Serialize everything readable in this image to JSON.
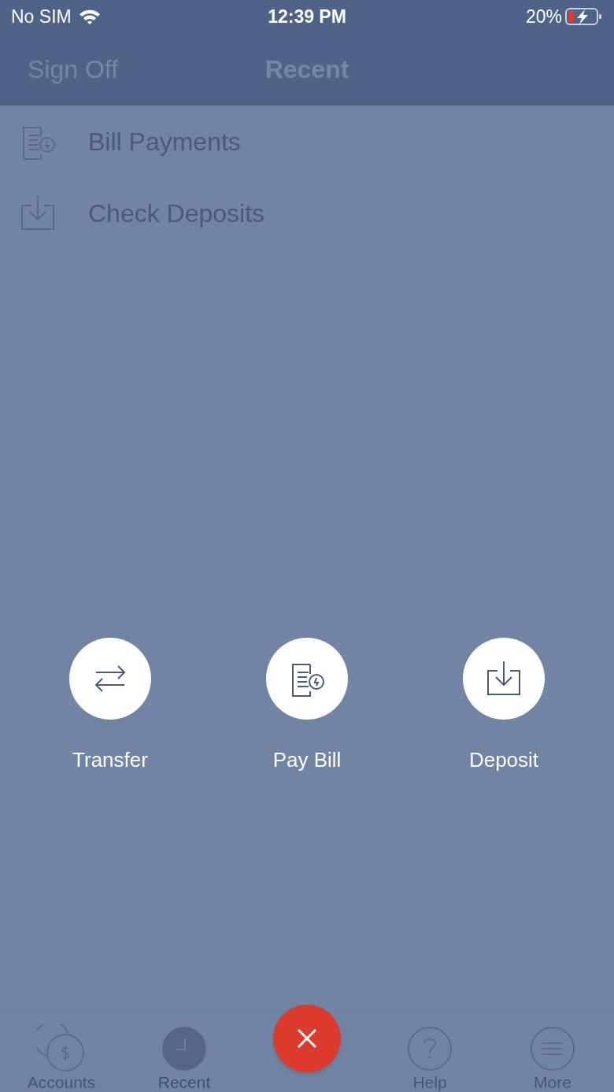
{
  "status_bar": {
    "carrier": "No SIM",
    "time": "12:39 PM",
    "battery": "20%"
  },
  "header": {
    "left_button": "Sign Off",
    "title": "Recent"
  },
  "menu_items": [
    {
      "kind": "bill",
      "label": "Bill Payments"
    },
    {
      "kind": "deposit",
      "label": "Check Deposits"
    }
  ],
  "quick_actions": [
    {
      "kind": "transfer",
      "label": "Transfer"
    },
    {
      "kind": "bill",
      "label": "Pay Bill"
    },
    {
      "kind": "deposit",
      "label": "Deposit"
    }
  ],
  "tab_bar": [
    {
      "kind": "accounts",
      "label": "Accounts",
      "selected": false
    },
    {
      "kind": "recent",
      "label": "Recent",
      "selected": true
    },
    {
      "kind": "close"
    },
    {
      "kind": "help",
      "label": "Help",
      "selected": false
    },
    {
      "kind": "more",
      "label": "More",
      "selected": false
    }
  ]
}
